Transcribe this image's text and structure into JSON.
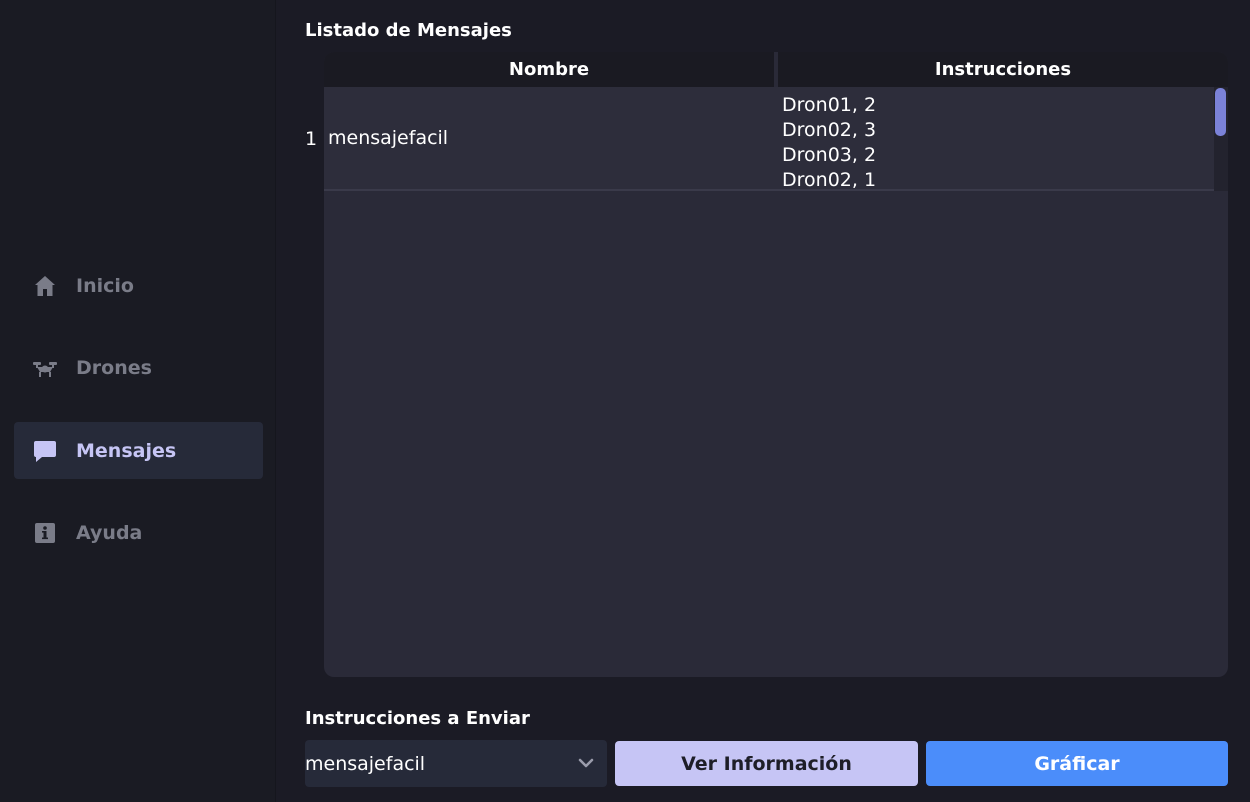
{
  "sidebar": {
    "items": [
      {
        "label": "Inicio",
        "icon": "home-icon",
        "active": false
      },
      {
        "label": "Drones",
        "icon": "drone-icon",
        "active": false
      },
      {
        "label": "Mensajes",
        "icon": "message-icon",
        "active": true
      },
      {
        "label": "Ayuda",
        "icon": "info-icon",
        "active": false
      }
    ]
  },
  "messages": {
    "title": "Listado de Mensajes",
    "columns": [
      "Nombre",
      "Instrucciones"
    ],
    "rows": [
      {
        "index": "1",
        "name": "mensajefacil",
        "instructions": [
          "Dron01, 2",
          "Dron02, 3",
          "Dron03, 2",
          "Dron02, 1"
        ]
      }
    ]
  },
  "send": {
    "title": "Instrucciones a Enviar",
    "selected": "mensajefacil",
    "info_button": "Ver Información",
    "graph_button": "Gráficar"
  },
  "colors": {
    "accent": "#c6c5f5",
    "primary_button": "#4b8dfa",
    "sidebar_active": "#262a39",
    "scroll_thumb": "#7b82d8"
  }
}
